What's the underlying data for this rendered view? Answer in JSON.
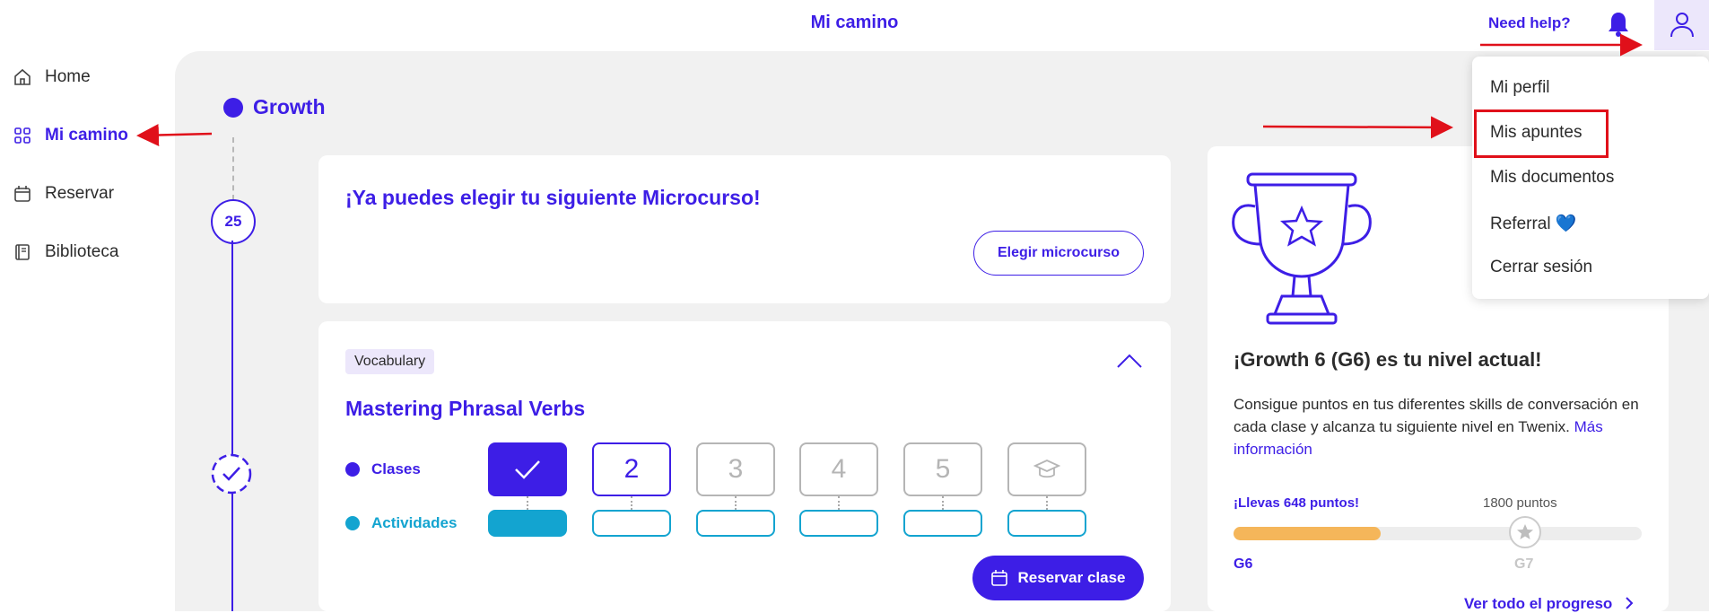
{
  "header": {
    "title": "Mi camino",
    "help_label": "Need help?"
  },
  "sidebar": {
    "items": [
      {
        "label": "Home",
        "icon": "home-icon"
      },
      {
        "label": "Mi camino",
        "icon": "grid-icon",
        "active": true
      },
      {
        "label": "Reservar",
        "icon": "calendar-icon"
      },
      {
        "label": "Biblioteca",
        "icon": "book-icon"
      }
    ]
  },
  "path": {
    "title": "Growth",
    "level_number": "25"
  },
  "next_course_card": {
    "title": "¡Ya puedes elegir tu siguiente Microcurso!",
    "button_label": "Elegir microcurso"
  },
  "course_card": {
    "tag": "Vocabulary",
    "title": "Mastering Phrasal Verbs",
    "classes_label": "Clases",
    "activities_label": "Actividades",
    "class_steps": [
      "2",
      "3",
      "4",
      "5"
    ],
    "book_button_label": "Reservar clase"
  },
  "level_card": {
    "title": "¡Growth 6 (G6) es tu nivel actual!",
    "description": "Consigue puntos en tus diferentes skills de conversación en cada clase y alcanza tu siguiente nivel en Twenix.",
    "more_info_link": "Más información",
    "points_now": "¡Llevas 648 puntos!",
    "points_target": "1800 puntos",
    "progress_fraction": 0.36,
    "current_level": "G6",
    "next_level": "G7",
    "progress_link": "Ver todo el progreso"
  },
  "profile_menu": {
    "items": [
      "Mi perfil",
      "Mis apuntes",
      "Mis documentos",
      "Referral 💙",
      "Cerrar sesión"
    ]
  },
  "colors": {
    "brand": "#3d1ee6",
    "activities": "#13a4d0",
    "progress": "#f5b65a",
    "annotation": "#e0101a"
  }
}
